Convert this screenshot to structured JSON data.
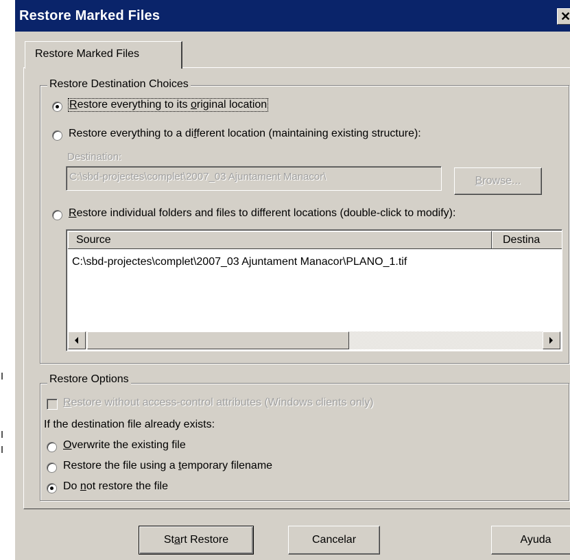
{
  "window": {
    "title": "Restore Marked Files",
    "close_glyph": "✕"
  },
  "tab": {
    "label": "Restore Marked Files"
  },
  "destination_group": {
    "legend": "Restore Destination Choices",
    "opt_original": {
      "pre": "",
      "hot": "R",
      "post": "estore everything to its ",
      "hot2": "o",
      "post2": "riginal location",
      "checked": true
    },
    "opt_different": {
      "pre": "Restore everything to a di",
      "hot": "f",
      "post": "ferent location (maintaining existing structure):",
      "checked": false
    },
    "destination_label": "Destination:",
    "destination_value": "C:\\sbd-projectes\\complet\\2007_03 Ajuntament Manacor\\",
    "browse_pre": "B",
    "browse_post": "rowse...",
    "opt_individual": {
      "pre": "",
      "hot": "R",
      "post": "estore individual folders and files to different locations (double-click to modify):",
      "checked": false
    },
    "list_columns": [
      "Source",
      "Destina"
    ],
    "list_rows": [
      "C:\\sbd-projectes\\complet\\2007_03 Ajuntament Manacor\\PLANO_1.tif"
    ]
  },
  "options_group": {
    "legend": "Restore Options",
    "acl_checkbox": {
      "hot": "R",
      "post": "estore without access-control attributes (Windows clients only)",
      "checked": false,
      "disabled": true
    },
    "exists_prompt": "If the destination file already exists:",
    "overwrite": {
      "hot": "O",
      "post": "verwrite the existing file",
      "checked": false
    },
    "temp_name": {
      "pre": "Restore the file using a ",
      "hot": "t",
      "post": "emporary filename",
      "checked": false
    },
    "no_restore": {
      "pre": "Do ",
      "hot": "n",
      "post": "ot restore the file",
      "checked": true
    }
  },
  "buttons": {
    "start_pre": "St",
    "start_hot": "a",
    "start_post": "rt Restore",
    "cancel": "Cancelar",
    "help": "Ayuda"
  }
}
